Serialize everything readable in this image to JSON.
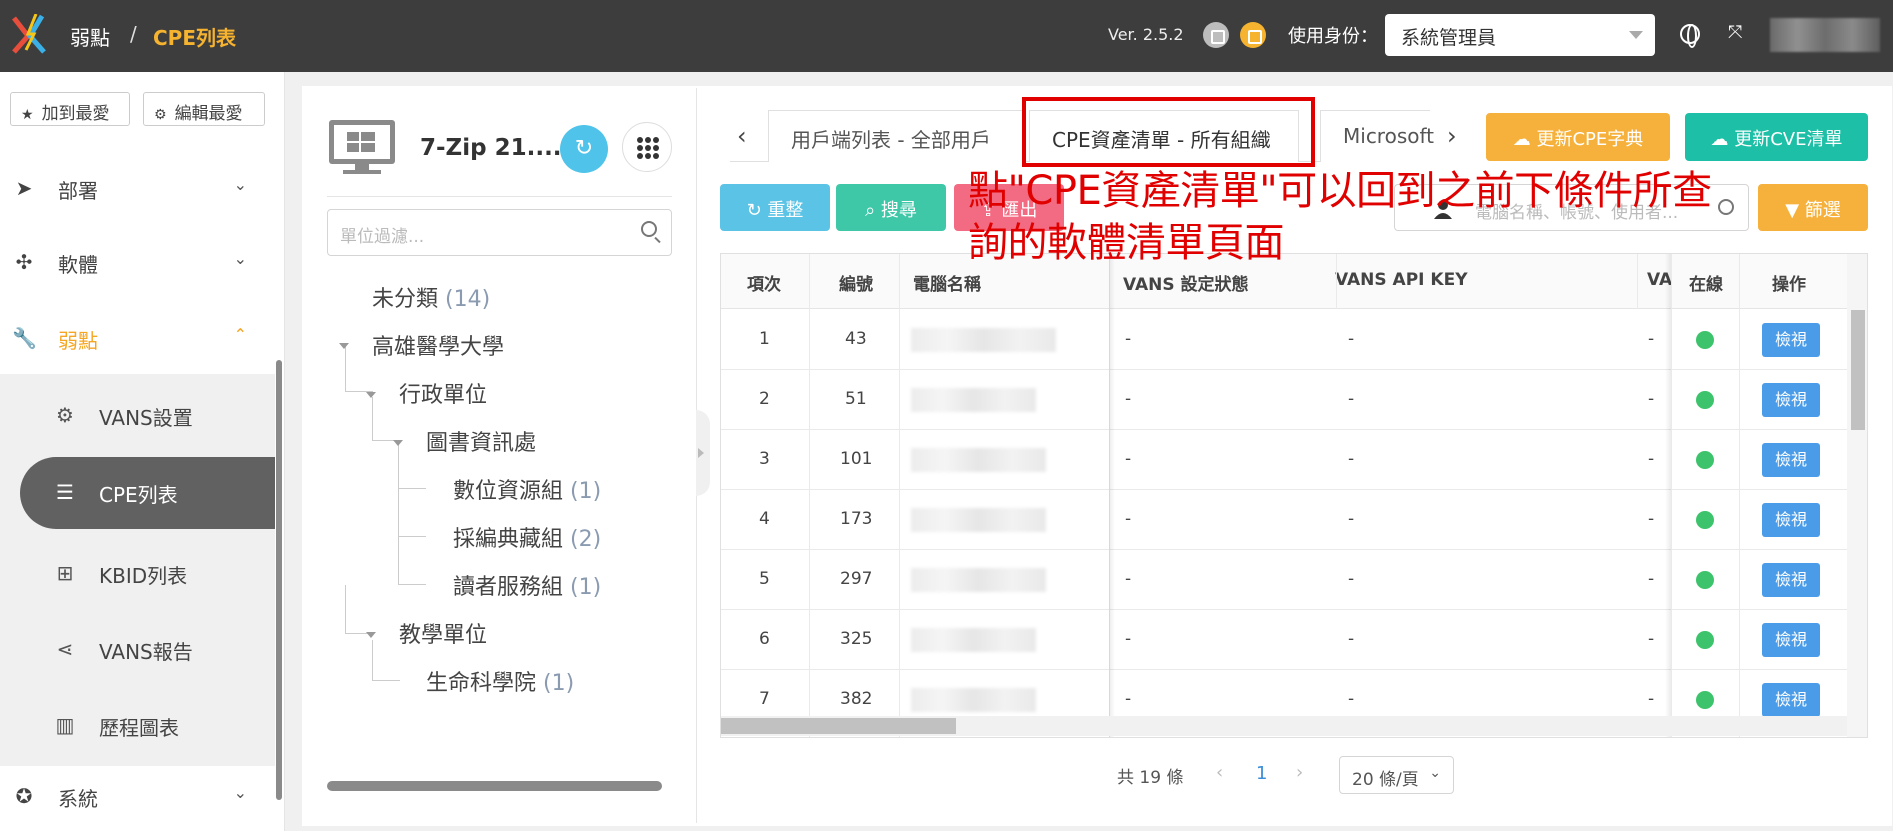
{
  "header": {
    "breadcrumb_root": "弱點",
    "breadcrumb_sep": "/",
    "breadcrumb_current": "CPE列表",
    "version": "Ver. 2.5.2",
    "identity_label": "使用身份：",
    "identity_value": "系統管理員"
  },
  "sidebar": {
    "fav_add": "加到最愛",
    "fav_edit": "編輯最愛",
    "items": [
      {
        "label": "部署",
        "icon": "paper-plane-icon"
      },
      {
        "label": "軟體",
        "icon": "puzzle-icon"
      },
      {
        "label": "弱點",
        "icon": "wrench-icon"
      }
    ],
    "sub_items": [
      {
        "label": "VANS設置",
        "icon": "gear-icon"
      },
      {
        "label": "CPE列表",
        "icon": "list-icon"
      },
      {
        "label": "KBID列表",
        "icon": "windows-icon"
      },
      {
        "label": "VANS報告",
        "icon": "share-icon"
      },
      {
        "label": "歷程圖表",
        "icon": "bar-chart-icon"
      }
    ],
    "system_label": "系統"
  },
  "tree": {
    "title": "7-Zip 21....",
    "filter_placeholder": "單位過濾...",
    "nodes": [
      {
        "label": "未分類",
        "count": "(14)"
      },
      {
        "label": "高雄醫學大學",
        "count": ""
      },
      {
        "label": "行政單位",
        "count": ""
      },
      {
        "label": "圖書資訊處",
        "count": ""
      },
      {
        "label": "數位資源組",
        "count": "(1)"
      },
      {
        "label": "採編典藏組",
        "count": "(2)"
      },
      {
        "label": "讀者服務組",
        "count": "(1)"
      },
      {
        "label": "教學單位",
        "count": ""
      },
      {
        "label": "生命科學院",
        "count": "(1)"
      }
    ]
  },
  "tabs": {
    "items": [
      "用戶端列表 - 全部用戶",
      "CPE資產清單 - 所有組織",
      "Microsoft"
    ],
    "update_cpe": "更新CPE字典",
    "update_cve": "更新CVE清單"
  },
  "toolbar": {
    "reset": "重整",
    "search": "搜尋",
    "export": "匯出",
    "filter": "篩選",
    "search_placeholder": "電腦名稱、帳號、使用者..."
  },
  "annotation": {
    "line1": "點\"CPE資產清單\"可以回到之前下條件所查",
    "line2": "詢的軟體清單頁面"
  },
  "table": {
    "headers": [
      "項次",
      "編號",
      "電腦名稱",
      "VANS 設定狀態",
      "VANS API KEY",
      "VA",
      "在線",
      "操作"
    ],
    "rows": [
      {
        "idx": "1",
        "id": "43",
        "vans": "-",
        "key": "-",
        "va": "-",
        "action": "檢視"
      },
      {
        "idx": "2",
        "id": "51",
        "vans": "-",
        "key": "-",
        "va": "-",
        "action": "檢視"
      },
      {
        "idx": "3",
        "id": "101",
        "vans": "-",
        "key": "-",
        "va": "-",
        "action": "檢視"
      },
      {
        "idx": "4",
        "id": "173",
        "vans": "-",
        "key": "-",
        "va": "-",
        "action": "檢視"
      },
      {
        "idx": "5",
        "id": "297",
        "vans": "-",
        "key": "-",
        "va": "-",
        "action": "檢視"
      },
      {
        "idx": "6",
        "id": "325",
        "vans": "-",
        "key": "-",
        "va": "-",
        "action": "檢視"
      },
      {
        "idx": "7",
        "id": "382",
        "vans": "-",
        "key": "-",
        "va": "-",
        "action": "檢視"
      }
    ],
    "online_color": "#3cc36b"
  },
  "pagination": {
    "total": "共 19 條",
    "current": "1",
    "page_size": "20 條/頁"
  },
  "colors": {
    "accent": "#f5a623",
    "topbar": "#3d3d3d",
    "highlight": "#e00000"
  }
}
